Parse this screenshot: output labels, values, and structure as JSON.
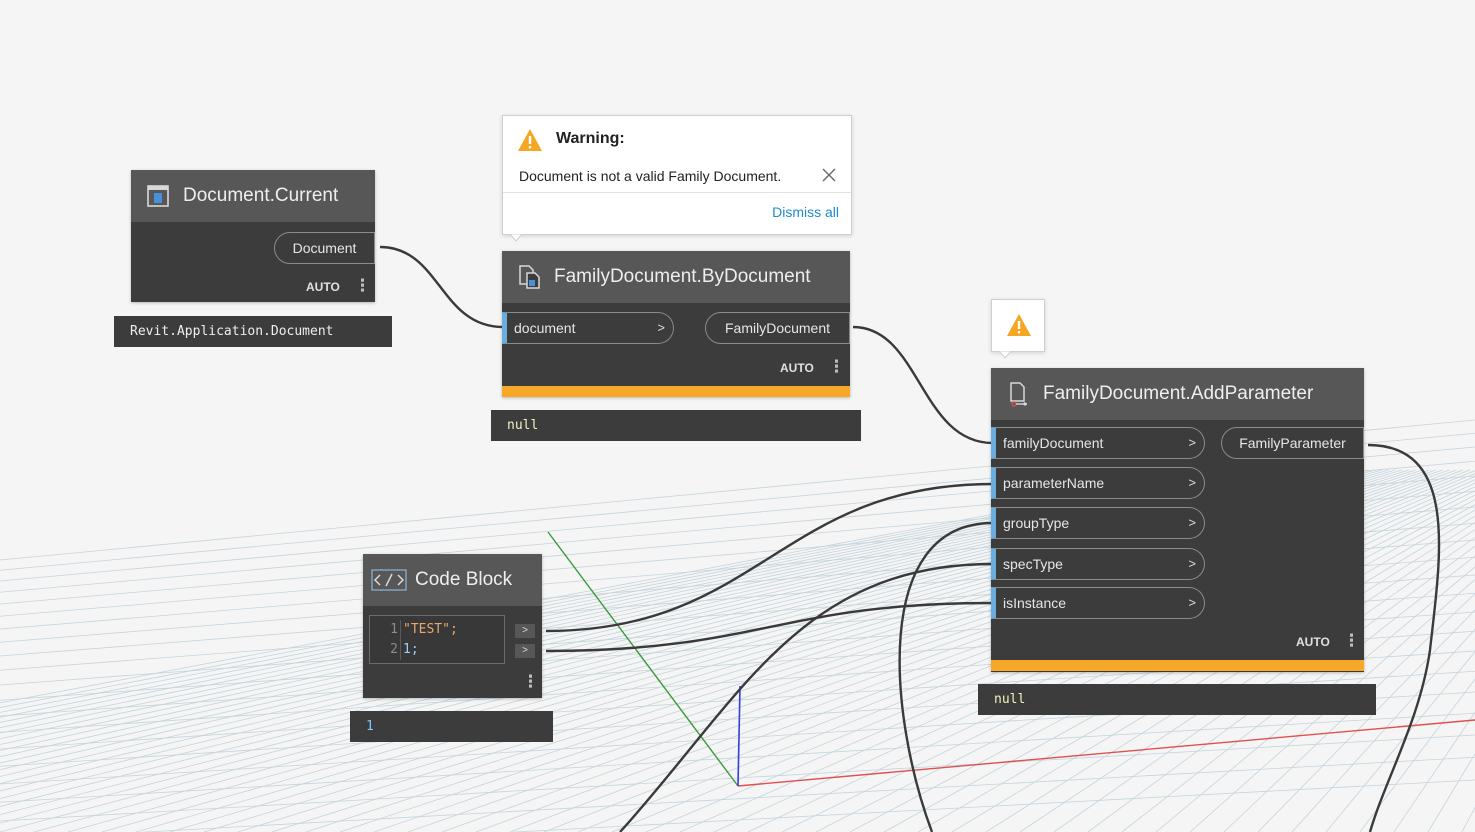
{
  "colors": {
    "accent_input": "#6aaee0",
    "warning_bar": "#f7a829",
    "warning_icon": "#f5a623",
    "link": "#1f8ccc",
    "node_body": "#3c3c3c",
    "node_header": "#575757",
    "grid_line": "#c4d4dc",
    "axis_x": "#e05050",
    "axis_y": "#3a9a3a",
    "axis_z": "#3040d8",
    "wire": "#3a3a3a"
  },
  "warning_popup": {
    "title": "Warning:",
    "message": "Document is not a valid Family Document.",
    "dismiss_label": "Dismiss all",
    "icon": "warning-triangle-icon",
    "close_icon": "close-icon"
  },
  "nodes": {
    "document_current": {
      "title": "Document.Current",
      "icon": "document-current-icon",
      "output_label": "Document",
      "lacing": "AUTO",
      "preview": "Revit.Application.Document"
    },
    "family_by_document": {
      "title": "FamilyDocument.ByDocument",
      "icon": "family-document-icon",
      "input_label": "document",
      "output_label": "FamilyDocument",
      "lacing": "AUTO",
      "preview": "null"
    },
    "add_parameter": {
      "title": "FamilyDocument.AddParameter",
      "icon": "family-add-parameter-icon",
      "inputs": [
        "familyDocument",
        "parameterName",
        "groupType",
        "specType",
        "isInstance"
      ],
      "output_label": "FamilyParameter",
      "lacing": "AUTO",
      "preview": "null",
      "warning_badge_icon": "warning-triangle-icon"
    },
    "code_block": {
      "title": "Code Block",
      "icon": "code-block-icon",
      "lines": [
        {
          "number": "1",
          "text": "\"TEST\";"
        },
        {
          "number": "2",
          "text": "1;"
        }
      ],
      "output_glyph": ">",
      "preview": "1"
    }
  },
  "common": {
    "chevron": ">",
    "kebab": "⋮"
  }
}
